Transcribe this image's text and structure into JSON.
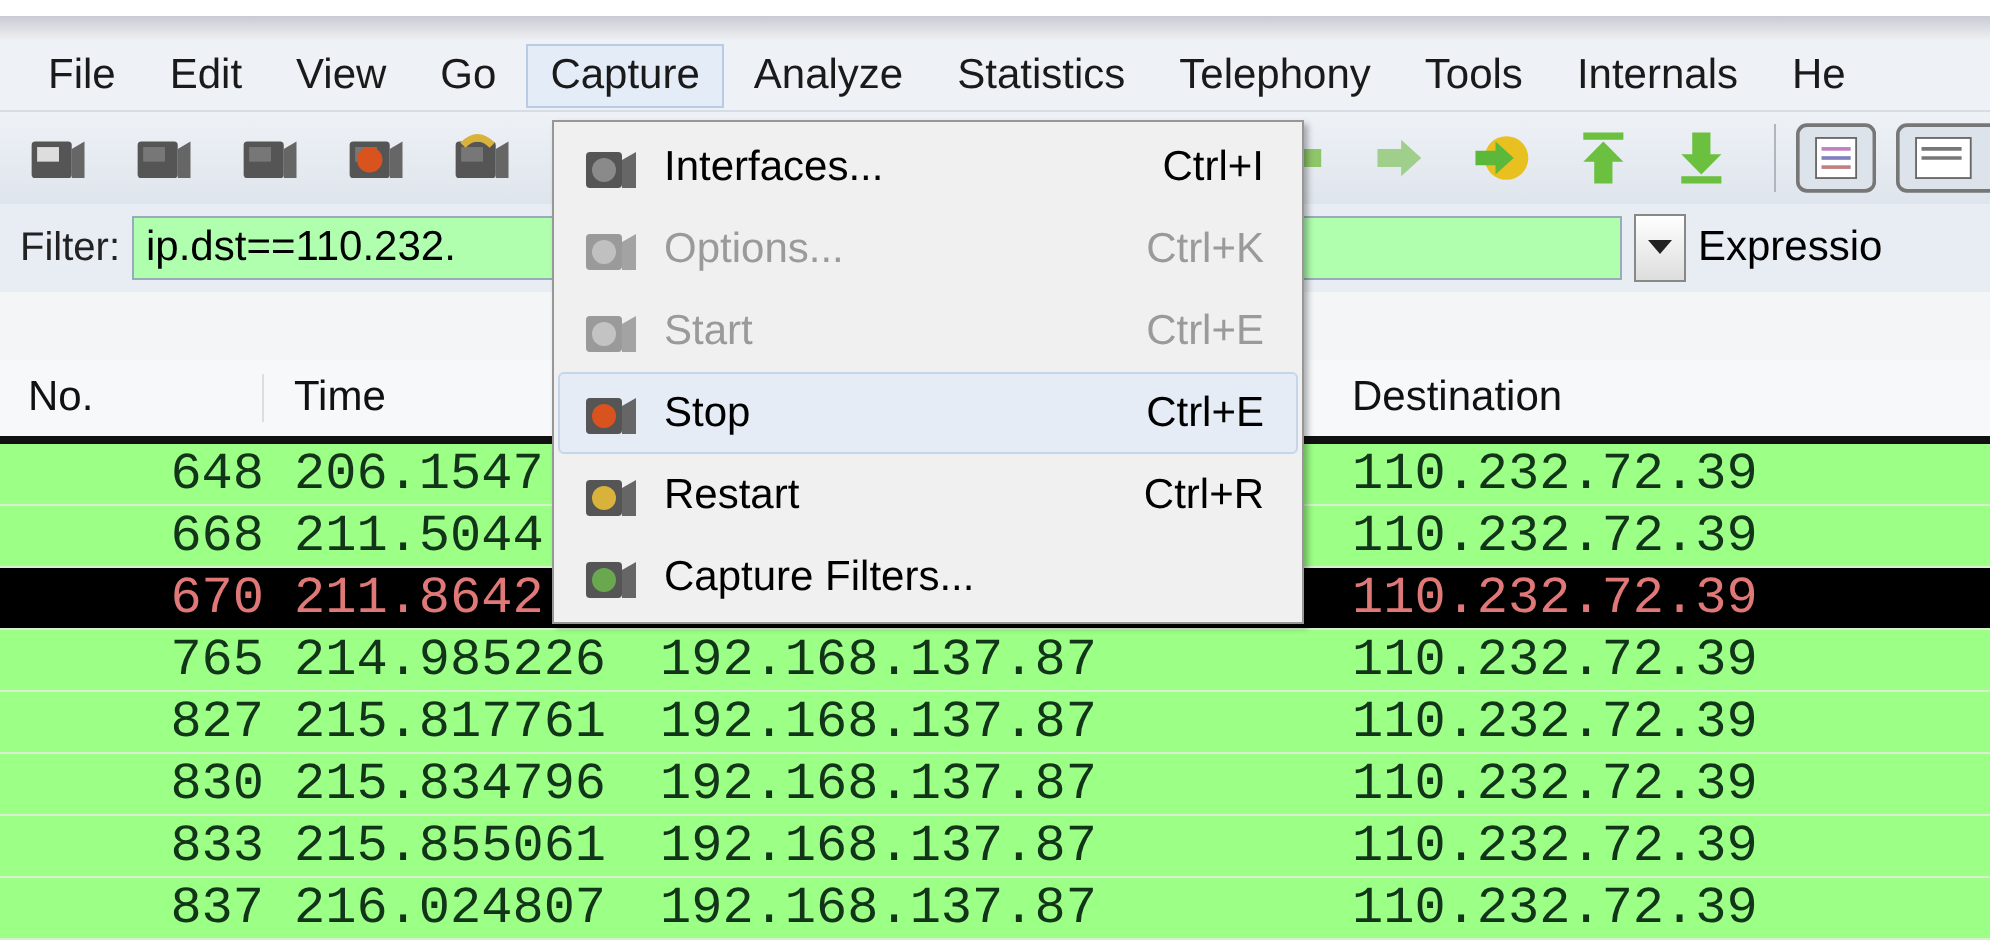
{
  "menu_bar": [
    {
      "label": "File",
      "selected": false
    },
    {
      "label": "Edit",
      "selected": false
    },
    {
      "label": "View",
      "selected": false
    },
    {
      "label": "Go",
      "selected": false
    },
    {
      "label": "Capture",
      "selected": true
    },
    {
      "label": "Analyze",
      "selected": false
    },
    {
      "label": "Statistics",
      "selected": false
    },
    {
      "label": "Telephony",
      "selected": false
    },
    {
      "label": "Tools",
      "selected": false
    },
    {
      "label": "Internals",
      "selected": false
    },
    {
      "label": "He",
      "selected": false
    }
  ],
  "capture_menu": [
    {
      "label": "Interfaces...",
      "shortcut": "Ctrl+I",
      "disabled": false,
      "selected": false
    },
    {
      "label": "Options...",
      "shortcut": "Ctrl+K",
      "disabled": true,
      "selected": false
    },
    {
      "label": "Start",
      "shortcut": "Ctrl+E",
      "disabled": true,
      "selected": false
    },
    {
      "label": "Stop",
      "shortcut": "Ctrl+E",
      "disabled": false,
      "selected": true
    },
    {
      "label": "Restart",
      "shortcut": "Ctrl+R",
      "disabled": false,
      "selected": false
    },
    {
      "label": "Capture Filters...",
      "disabled": false,
      "selected": false
    }
  ],
  "filter": {
    "label": "Filter:",
    "value": "ip.dst==110.232.",
    "expression_button": "Expressio"
  },
  "packet_list": {
    "headers": {
      "no": "No.",
      "time": "Time",
      "destination": "Destination"
    },
    "rows": [
      {
        "no": "648",
        "time": "206.1547",
        "destination": "110.232.72.39",
        "selected": false
      },
      {
        "no": "668",
        "time": "211.5044",
        "destination": "110.232.72.39",
        "selected": false
      },
      {
        "no": "670",
        "time": "211.8642",
        "destination": "110.232.72.39",
        "selected": true
      },
      {
        "no": "765",
        "time": "214.985226",
        "source": "192.168.137.87",
        "destination": "110.232.72.39",
        "selected": false
      },
      {
        "no": "827",
        "time": "215.817761",
        "source": "192.168.137.87",
        "destination": "110.232.72.39",
        "selected": false
      },
      {
        "no": "830",
        "time": "215.834796",
        "source": "192.168.137.87",
        "destination": "110.232.72.39",
        "selected": false
      },
      {
        "no": "833",
        "time": "215.855061",
        "source": "192.168.137.87",
        "destination": "110.232.72.39",
        "selected": false
      },
      {
        "no": "837",
        "time": "216.024807",
        "source": "192.168.137.87",
        "destination": "110.232.72.39",
        "selected": false
      }
    ]
  }
}
